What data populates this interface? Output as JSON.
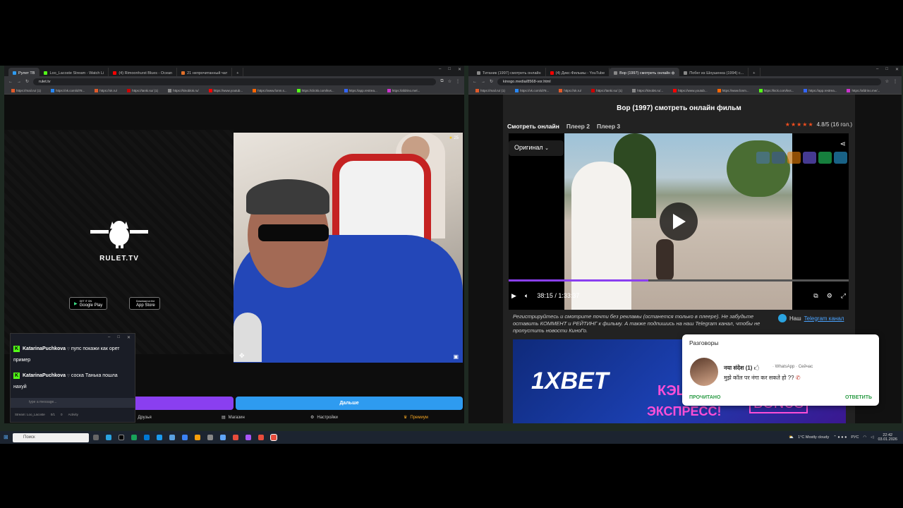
{
  "left_browser": {
    "tabs": [
      {
        "label": "Рулет ТВ",
        "active": true,
        "color": "#2e9bf0"
      },
      {
        "label": "Loo_Lacoste Stream - Watch Li",
        "active": false,
        "color": "#53fc18"
      },
      {
        "label": "(4) Rimoonhurst Blues - Ocean",
        "active": false,
        "color": "#ff0000"
      },
      {
        "label": "21 непрочитанный чат",
        "active": false,
        "color": "#e0702a"
      }
    ],
    "url": "rulet.tv",
    "bookmarks": [
      "https://mail.ru/ (1)",
      "https://vk.com/id78...",
      "https://ok.ru/",
      "https://tanki.su/ (1)",
      "https://kinoblok.ru/",
      "https://www.youtub...",
      "https://www.fonm.s...",
      "https://clickk.com/kvs...",
      "https://app.restrea...",
      "https://afdrino.mel..."
    ]
  },
  "rulet": {
    "brand": "RULET.TV",
    "google_play_top": "GET IT ON",
    "google_play": "Google Play",
    "app_store_top": "Download on the",
    "app_store": "App Store",
    "viewer_count": "25",
    "next_button": "Дальше",
    "nav": {
      "friends": "Друзья",
      "shop": "Магазин",
      "settings": "Настройки",
      "premium": "Премиум"
    }
  },
  "chat": {
    "messages": [
      {
        "user": "KatarinaPuchkova",
        "text": "пупс покажи как орет пример"
      },
      {
        "user": "KatarinaPuchkova",
        "text": "соска Танька пошла нахуй"
      }
    ],
    "input_placeholder": "type a message...",
    "footer": [
      "Stream: Loo_Lacoste",
      "0/1",
      "0",
      "Activity"
    ]
  },
  "right_browser": {
    "tabs": [
      {
        "label": "Титаник (1997) смотреть онлайн",
        "active": false,
        "color": "#888"
      },
      {
        "label": "(4) Дикс-Фильмы - YouTube",
        "active": false,
        "color": "#ff0000"
      },
      {
        "label": "Вор (1997) смотреть онлайн ф",
        "active": true,
        "color": "#888"
      },
      {
        "label": "Побег из Шоушенка (1994) с...",
        "active": false,
        "color": "#888"
      }
    ],
    "url": "kinogo.media/8568-vor.html",
    "bookmarks": [
      "https://mail.ru/ (1)",
      "https://vk.com/id78...",
      "https://ok.ru/",
      "https://tanki.su/ (1)",
      "https://kinob6.ru/...",
      "https://www.youtub...",
      "https://www.fonm...",
      "https://kick.com/kvs...",
      "https://app.restrea...",
      "https://afdrino.me/..."
    ]
  },
  "movie": {
    "title": "Вор (1997) смотреть онлайн фильм",
    "tabs": [
      "Смотреть онлайн",
      "Плеер 2",
      "Плеер 3"
    ],
    "rating_text": "4.8/5 (16 гол.)",
    "rating": 4.8,
    "quality_select": "Оригинал",
    "time": "38:15 / 1:33:37",
    "progress": 0.41,
    "description": "Регистрируйтесь и смотрите почти без рекламы (останется только в плеере). Не забудьте оставить КОММЕНТ и РЕЙТИНГ к фильму. А также подпишись на наш Telegram канал, чтобы не пропустить новости КиноГо.",
    "telegram_prefix": "Наш",
    "telegram_link": "Telegram канал"
  },
  "ad": {
    "brand": "1XBET",
    "line1": "КЭШ",
    "line2": "ЭКСПРЕСС!",
    "bonus": "BONUS"
  },
  "notification": {
    "title": "Разговоры",
    "sender": "नया संदेश (1)",
    "app": "WhatsApp",
    "time": "Сейчас",
    "body": "मुझे कॉल पर नंगा कर सकते हो ??",
    "action_read": "ПРОЧИТАНО",
    "action_reply": "ОТВЕТИТЬ"
  },
  "taskbar": {
    "search_placeholder": "Поиск",
    "weather": "1°C  Mostly cloudy",
    "lang": "РУС",
    "time": "22:42",
    "date": "03.01.2026"
  },
  "colors": {
    "kick_green": "#53fc18",
    "rulet_blue": "#2e9bf0",
    "rulet_purple": "#8a3ff0",
    "rating_orange": "#f24e1e",
    "whatsapp_green": "#2a9b44"
  }
}
